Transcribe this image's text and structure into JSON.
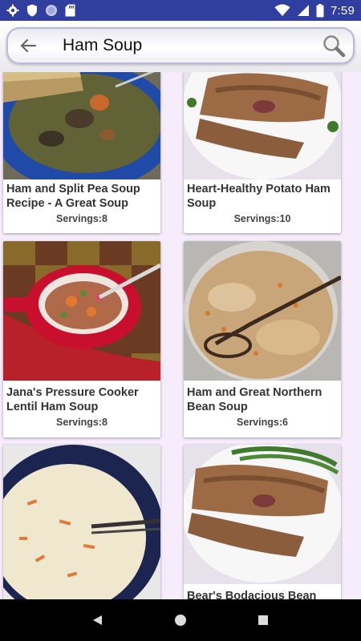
{
  "status_bar": {
    "time": "7:59",
    "icons": [
      "gear-icon",
      "shield-icon",
      "circle-icon",
      "sd-card-icon",
      "wifi-icon",
      "signal-icon",
      "battery-icon"
    ]
  },
  "search": {
    "query": "Ham Soup",
    "back_icon": "arrow-left-icon",
    "search_icon": "magnifier-icon"
  },
  "recipes": [
    {
      "title": "Ham and Split Pea Soup Recipe - A Great Soup",
      "servings": "Servings:8",
      "image": "split-pea-soup-bowl"
    },
    {
      "title": "Heart-Healthy Potato Ham Soup",
      "servings": "Servings:10",
      "image": "pork-chop-plate"
    },
    {
      "title": "Jana's Pressure Cooker Lentil Ham Soup",
      "servings": "Servings:8",
      "image": "red-mug-lentil-soup"
    },
    {
      "title": "Ham and Great Northern Bean Soup",
      "servings": "Servings:6",
      "image": "bean-soup-spoon"
    },
    {
      "title": "",
      "servings": "",
      "image": "creamy-soup-bowl"
    },
    {
      "title": "Bear's Bodacious Bean",
      "servings": "",
      "image": "pork-chop-plate"
    }
  ],
  "navigation": {
    "back_icon": "nav-back-triangle-icon",
    "home_icon": "nav-home-circle-icon",
    "recents_icon": "nav-recents-square-icon"
  },
  "colors": {
    "status_bar": "#303f9f",
    "background": "#f6ecfb",
    "card": "#ffffff"
  }
}
